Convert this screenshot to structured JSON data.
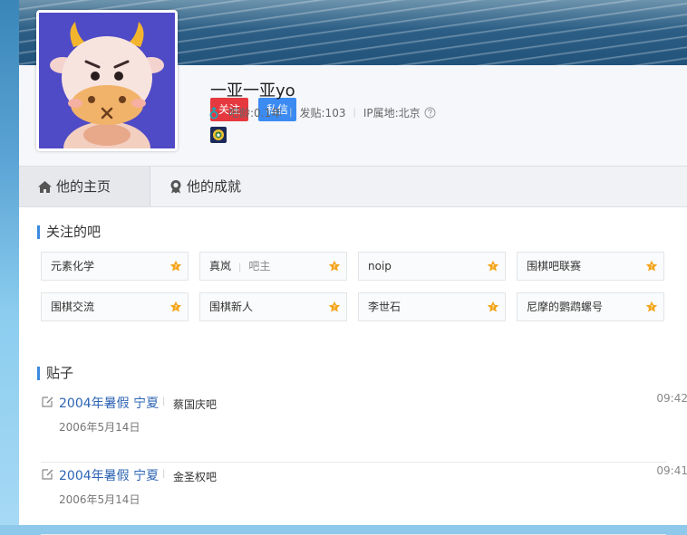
{
  "profile": {
    "follow_label": "关注",
    "message_label": "私信",
    "username": "一亚一亚yo",
    "age": "吧龄:0.1年",
    "posts": "发贴:103",
    "ip": "IP属地:北京"
  },
  "tabs": [
    {
      "label": "他的主页"
    },
    {
      "label": "他的成就"
    }
  ],
  "followed_bars": {
    "title": "关注的吧",
    "items": [
      {
        "name": "元素化学",
        "role": ""
      },
      {
        "name": "真岚",
        "role": "吧主"
      },
      {
        "name": "noip",
        "role": ""
      },
      {
        "name": "围棋吧联赛",
        "role": ""
      },
      {
        "name": "围棋交流",
        "role": ""
      },
      {
        "name": "围棋新人",
        "role": ""
      },
      {
        "name": "李世石",
        "role": ""
      },
      {
        "name": "尼摩的鹦鹉螺号",
        "role": ""
      }
    ]
  },
  "posts_section": {
    "title": "贴子",
    "items": [
      {
        "title": "2004年暑假 宁夏",
        "bar": "蔡国庆吧",
        "date": "2006年5月14日",
        "time": "09:42"
      },
      {
        "title": "2004年暑假 宁夏",
        "bar": "金圣权吧",
        "date": "2006年5月14日",
        "time": "09:41"
      }
    ]
  },
  "colors": {
    "accent": "#3b8ae0",
    "follow": "#e5393f",
    "message": "#3b8bf2",
    "link": "#2d64b3"
  }
}
